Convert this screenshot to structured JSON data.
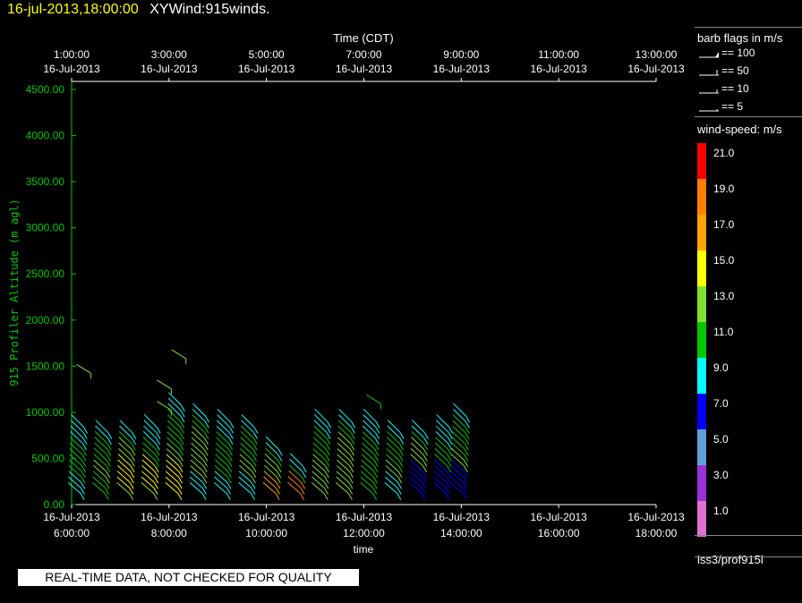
{
  "header": {
    "timestamp": "16-jul-2013,18:00:00",
    "title": "XYWind:915winds."
  },
  "qc_banner": "REAL-TIME DATA, NOT CHECKED FOR QUALITY",
  "legend": {
    "barb_title": "barb flags in m/s",
    "barb_items": [
      {
        "symbol": "flag",
        "label": "== 100"
      },
      {
        "symbol": "pennant",
        "label": "== 50"
      },
      {
        "symbol": "full-barb",
        "label": "== 10"
      },
      {
        "symbol": "half-barb",
        "label": "== 5"
      }
    ],
    "speed_title": "wind-speed: m/s",
    "colorbar": [
      {
        "label": "21.0",
        "color": "#ff0000"
      },
      {
        "label": "19.0",
        "color": "#ff8000"
      },
      {
        "label": "17.0",
        "color": "#ffa500"
      },
      {
        "label": "15.0",
        "color": "#ffff00"
      },
      {
        "label": "13.0",
        "color": "#7fe030"
      },
      {
        "label": "11.0",
        "color": "#00c800"
      },
      {
        "label": "9.0",
        "color": "#00ffff"
      },
      {
        "label": "7.0",
        "color": "#0000ff"
      },
      {
        "label": "5.0",
        "color": "#5f9fd8"
      },
      {
        "label": "3.0",
        "color": "#9a30d8"
      },
      {
        "label": "1.0",
        "color": "#e070d0"
      }
    ],
    "source": "iss3/prof915l"
  },
  "chart_data": {
    "type": "scatter",
    "title": "",
    "top_axis_label": "Time (CDT)",
    "top_ticks": [
      {
        "time": "1:00:00",
        "date": "16-Jul-2013"
      },
      {
        "time": "3:00:00",
        "date": "16-Jul-2013"
      },
      {
        "time": "5:00:00",
        "date": "16-Jul-2013"
      },
      {
        "time": "7:00:00",
        "date": "16-Jul-2013"
      },
      {
        "time": "9:00:00",
        "date": "16-Jul-2013"
      },
      {
        "time": "11:00:00",
        "date": "16-Jul-2013"
      },
      {
        "time": "13:00:00",
        "date": "16-Jul-2013"
      }
    ],
    "xlabel": "time",
    "bottom_ticks": [
      {
        "date": "16-Jul-2013",
        "time": "6:00:00"
      },
      {
        "date": "16-Jul-2013",
        "time": "8:00:00"
      },
      {
        "date": "16-Jul-2013",
        "time": "10:00:00"
      },
      {
        "date": "16-Jul-2013",
        "time": "12:00:00"
      },
      {
        "date": "16-Jul-2013",
        "time": "14:00:00"
      },
      {
        "date": "16-Jul-2013",
        "time": "16:00:00"
      },
      {
        "date": "16-Jul-2013",
        "time": "18:00:00"
      }
    ],
    "xlim_hours_utc": [
      6.0,
      18.0
    ],
    "ylabel": "915 Profiler Altitude (m agl)",
    "yticks": [
      "0.00",
      "500.00",
      "1000.00",
      "1500.00",
      "2000.00",
      "2500.00",
      "3000.00",
      "3500.00",
      "4000.00",
      "4500.00"
    ],
    "ylim": [
      0,
      4600
    ],
    "profile_times_utc_hours": [
      6.25,
      6.75,
      7.25,
      7.75,
      8.25,
      8.75,
      9.25,
      9.75,
      10.25,
      10.75,
      11.25,
      11.75,
      12.25,
      12.75,
      13.25,
      13.75,
      14.1
    ],
    "profile_tops_m": [
      850,
      780,
      820,
      850,
      1100,
      1000,
      900,
      880,
      600,
      450,
      900,
      950,
      900,
      800,
      800,
      850,
      1000
    ],
    "isolated_points": [
      {
        "t": 6.25,
        "alt": 1520,
        "speed": 13
      },
      {
        "t": 7.9,
        "alt": 1350,
        "speed": 13
      },
      {
        "t": 7.9,
        "alt": 1120,
        "speed": 13
      },
      {
        "t": 8.2,
        "alt": 1680,
        "speed": 13
      },
      {
        "t": 12.2,
        "alt": 1190,
        "speed": 11
      }
    ],
    "gate_spacing_m": 60,
    "grid": false
  }
}
